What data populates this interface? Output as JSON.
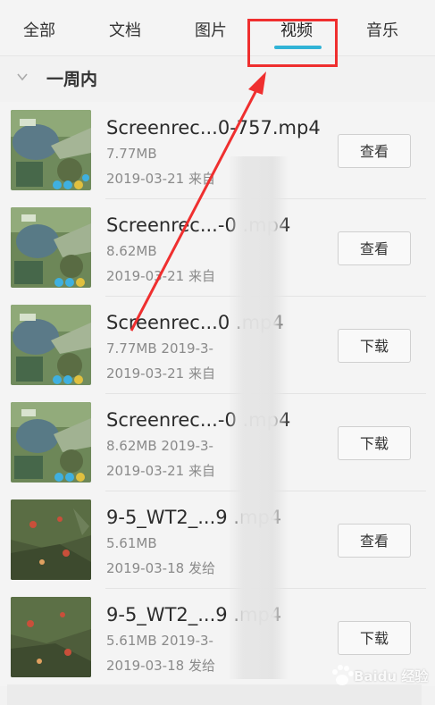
{
  "tabs": [
    {
      "label": "全部"
    },
    {
      "label": "文档"
    },
    {
      "label": "图片"
    },
    {
      "label": "视频",
      "active": true
    },
    {
      "label": "音乐"
    }
  ],
  "section": {
    "title": "一周内"
  },
  "files": [
    {
      "name": "Screenrec...0-757.mp4",
      "size": "7.77MB",
      "date": "2019-03-21 来自",
      "action": "查看",
      "thumb": "game-map"
    },
    {
      "name": "Screenrec...-0    .mp4",
      "size": "8.62MB",
      "date": "2019-03-21 来自",
      "action": "查看",
      "thumb": "game-map"
    },
    {
      "name": "Screenrec...0    .mp4",
      "size": "7.77MB 2019-3-",
      "date": "2019-03-21 来自",
      "action": "下载",
      "thumb": "game-map"
    },
    {
      "name": "Screenrec...-0    .mp4",
      "size": "8.62MB 2019-3-",
      "date": "2019-03-21 来自",
      "action": "下载",
      "thumb": "game-map"
    },
    {
      "name": "9-5_WT2_...9    .mp4",
      "size": "5.61MB",
      "date": "2019-03-18 发给",
      "action": "查看",
      "thumb": "game-scene"
    },
    {
      "name": "9-5_WT2_...9    .mp4",
      "size": "5.61MB 2019-3-",
      "date": "2019-03-18 发给",
      "action": "下载",
      "thumb": "game-scene"
    }
  ],
  "watermark": {
    "text": "Baidu 经验"
  },
  "colors": {
    "accent": "#31b3d6",
    "highlight": "#ef2f2f"
  },
  "icons": {
    "chevron": "chevron-down-icon",
    "arrow": "annotation-arrow"
  }
}
